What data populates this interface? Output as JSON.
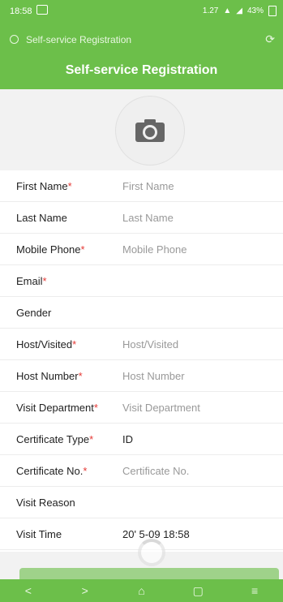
{
  "status_bar": {
    "time": "18:58",
    "network": "1.27",
    "battery": "43%"
  },
  "browser": {
    "title": "Self-service Registration"
  },
  "header": {
    "title": "Self-service Registration"
  },
  "form": {
    "fields": [
      {
        "label": "First Name",
        "required": "*",
        "value": "First Name",
        "filled": false
      },
      {
        "label": "Last Name",
        "required": "",
        "value": "Last Name",
        "filled": false
      },
      {
        "label": "Mobile Phone",
        "required": "*",
        "value": "Mobile Phone",
        "filled": false
      },
      {
        "label": "Email",
        "required": "*",
        "value": "",
        "filled": false
      },
      {
        "label": "Gender",
        "required": "",
        "value": "",
        "filled": false
      },
      {
        "label": "Host/Visited",
        "required": "*",
        "value": "Host/Visited",
        "filled": false
      },
      {
        "label": "Host Number",
        "required": "*",
        "value": "Host Number",
        "filled": false
      },
      {
        "label": "Visit Department",
        "required": "*",
        "value": "Visit Department",
        "filled": false
      },
      {
        "label": "Certificate Type",
        "required": "*",
        "value": "ID",
        "filled": true
      },
      {
        "label": "Certificate No.",
        "required": "*",
        "value": "Certificate No.",
        "filled": false
      },
      {
        "label": "Visit Reason",
        "required": "",
        "value": "",
        "filled": false
      },
      {
        "label": "Visit Time",
        "required": "",
        "value": "20' 5-09 18:58",
        "filled": true
      }
    ]
  },
  "nav": {
    "back": "<",
    "forward": ">",
    "home": "⌂",
    "tabs": "▢",
    "menu": "≡"
  },
  "colors": {
    "primary": "#6cbf4a",
    "required": "#e53935"
  }
}
